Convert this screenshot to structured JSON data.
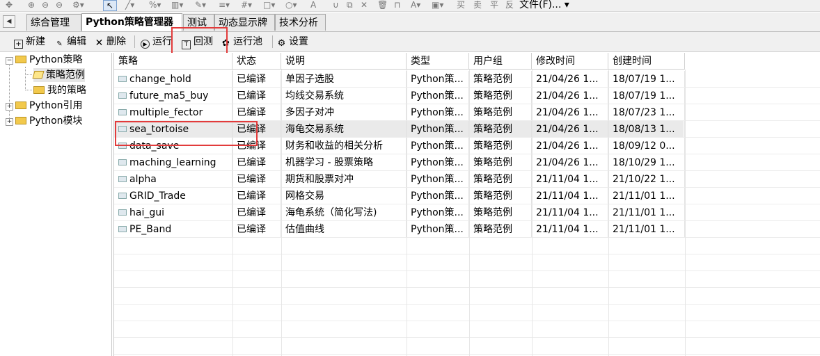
{
  "top_menu": {
    "file": "文件(F)..."
  },
  "tabs": [
    "综合管理",
    "Python策略管理器",
    "测试",
    "动态显示牌",
    "技术分析"
  ],
  "actions": {
    "new": "新建",
    "edit": "编辑",
    "delete": "删除",
    "run": "运行",
    "backtest": "回测",
    "run_pool": "运行池",
    "settings": "设置"
  },
  "tree": {
    "root": "Python策略",
    "child1": "策略范例",
    "child2": "我的策略",
    "ref": "Python引用",
    "module": "Python模块"
  },
  "columns": [
    "策略",
    "状态",
    "说明",
    "类型",
    "用户组",
    "修改时间",
    "创建时间"
  ],
  "rows": [
    [
      "change_hold",
      "已编译",
      "单因子选股",
      "Python策...",
      "策略范例",
      "21/04/26 1...",
      "18/07/19 1..."
    ],
    [
      "future_ma5_buy",
      "已编译",
      "均线交易系统",
      "Python策...",
      "策略范例",
      "21/04/26 1...",
      "18/07/19 1..."
    ],
    [
      "multiple_fector",
      "已编译",
      "多因子对冲",
      "Python策...",
      "策略范例",
      "21/04/26 1...",
      "18/07/23 1..."
    ],
    [
      "sea_tortoise",
      "已编译",
      "海龟交易系统",
      "Python策...",
      "策略范例",
      "21/04/26 1...",
      "18/08/13 1..."
    ],
    [
      "data_save",
      "已编译",
      "财务和收益的相关分析",
      "Python策...",
      "策略范例",
      "21/04/26 1...",
      "18/09/12 0..."
    ],
    [
      "maching_learning",
      "已编译",
      "机器学习 - 股票策略",
      "Python策...",
      "策略范例",
      "21/04/26 1...",
      "18/10/29 1..."
    ],
    [
      "alpha",
      "已编译",
      "期货和股票对冲",
      "Python策...",
      "策略范例",
      "21/11/04 1...",
      "21/10/22 1..."
    ],
    [
      "GRID_Trade",
      "已编译",
      "网格交易",
      "Python策...",
      "策略范例",
      "21/11/04 1...",
      "21/11/01 1..."
    ],
    [
      "hai_gui",
      "已编译",
      "海龟系统（简化写法)",
      "Python策...",
      "策略范例",
      "21/11/04 1...",
      "21/11/01 1..."
    ],
    [
      "PE_Band",
      "已编译",
      "估值曲线",
      "Python策...",
      "策略范例",
      "21/11/04 1...",
      "21/11/01 1..."
    ]
  ],
  "colors": {
    "highlight": "#e23b3b",
    "selected_row": "#eaeaea"
  }
}
